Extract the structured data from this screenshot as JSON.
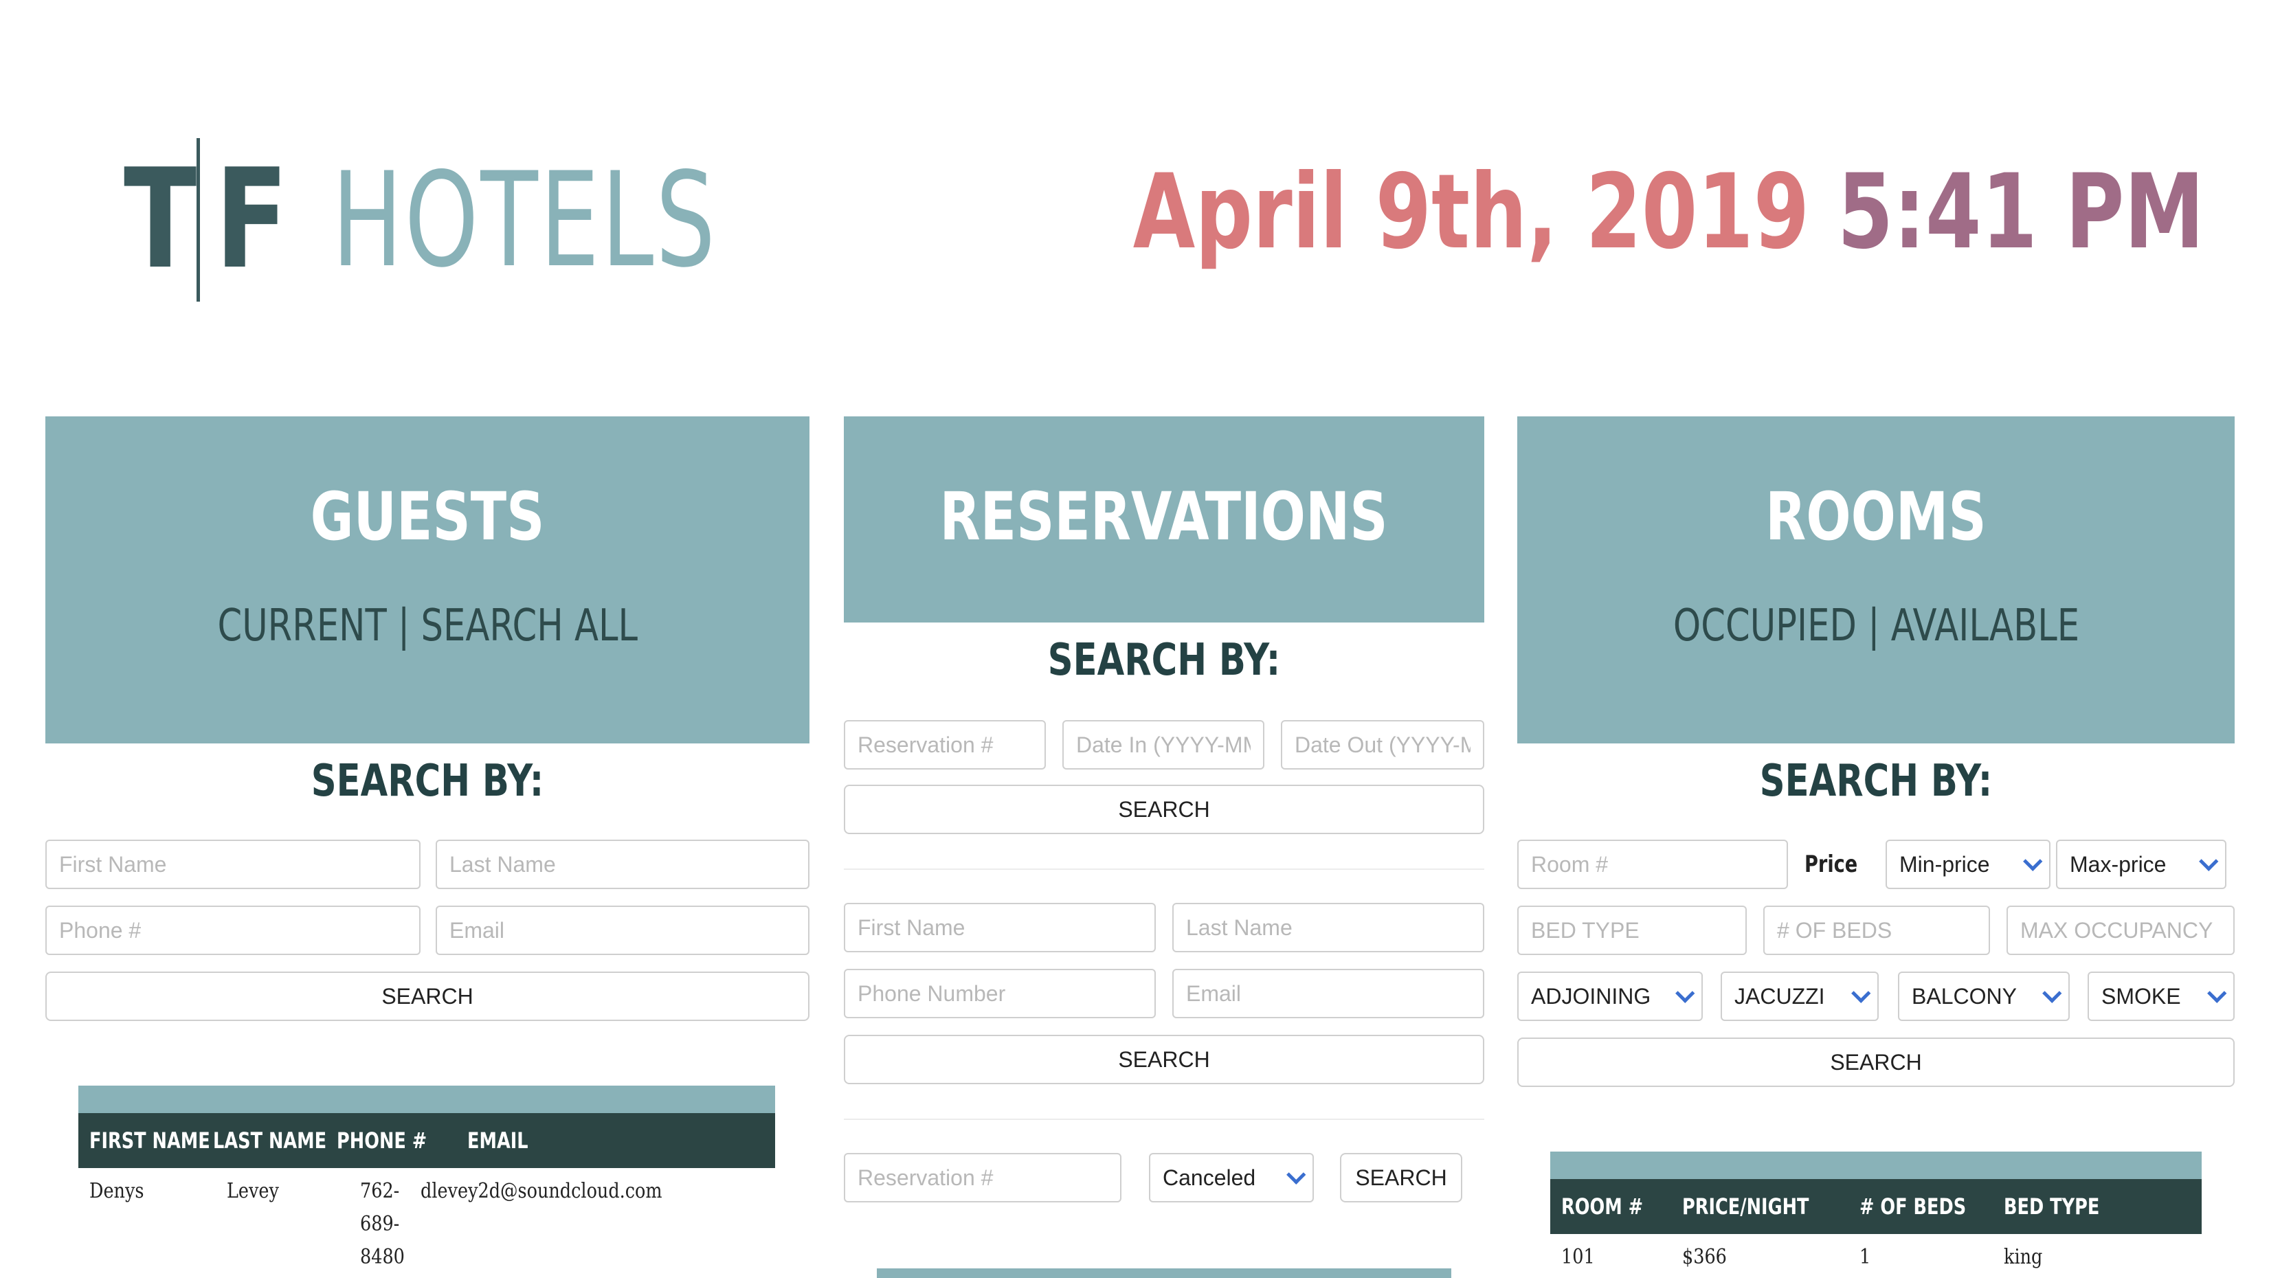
{
  "header": {
    "logo_t": "T",
    "logo_f": "F",
    "logo_text": "HOTELS",
    "date": "April 9th, 2019",
    "time": "5:41 PM"
  },
  "guests": {
    "title": "GUESTS",
    "link_current": "CURRENT",
    "separator": "|",
    "link_all": "SEARCH ALL",
    "search_by": "SEARCH BY:",
    "first_name_placeholder": "First Name",
    "last_name_placeholder": "Last Name",
    "phone_placeholder": "Phone #",
    "email_placeholder": "Email",
    "search_label": "SEARCH",
    "table": {
      "headers": [
        "FIRST NAME",
        "LAST NAME",
        "PHONE #",
        "EMAIL"
      ],
      "rows": [
        {
          "first": "Denys",
          "last": "Levey",
          "phone_1": "762-",
          "phone_2": "689-",
          "phone_3": "8480",
          "email": "dlevey2d@soundcloud.com"
        }
      ]
    }
  },
  "reservations": {
    "title": "RESERVATIONS",
    "search_by": "SEARCH BY:",
    "res_num_placeholder": "Reservation #",
    "date_in_placeholder": "Date In (YYYY-MM-DD)",
    "date_out_placeholder": "Date Out (YYYY-MM-DD)",
    "search_label_1": "SEARCH",
    "first_name_placeholder": "First Name",
    "last_name_placeholder": "Last Name",
    "phone_placeholder": "Phone Number",
    "email_placeholder": "Email",
    "search_label_2": "SEARCH",
    "res_num_placeholder_2": "Reservation #",
    "status_selected": "Canceled",
    "search_label_3": "SEARCH"
  },
  "rooms": {
    "title": "ROOMS",
    "link_occupied": "OCCUPIED",
    "separator": "|",
    "link_available": "AVAILABLE",
    "search_by": "SEARCH BY:",
    "room_num_placeholder": "Room #",
    "price_label": "Price",
    "min_price": "Min-price",
    "max_price": "Max-price",
    "bed_type_placeholder": "BED TYPE",
    "num_beds_placeholder": "# OF BEDS",
    "max_occupancy_placeholder": "MAX OCCUPANCY",
    "adjoining": "ADJOINING",
    "jacuzzi": "JACUZZI",
    "balcony": "BALCONY",
    "smoke": "SMOKE",
    "search_label": "SEARCH",
    "table": {
      "headers": [
        "ROOM #",
        "PRICE/NIGHT",
        "# OF BEDS",
        "BED TYPE"
      ],
      "rows": [
        {
          "room": "101",
          "price": "$366",
          "beds": "1",
          "bed_type": "king"
        }
      ]
    }
  }
}
